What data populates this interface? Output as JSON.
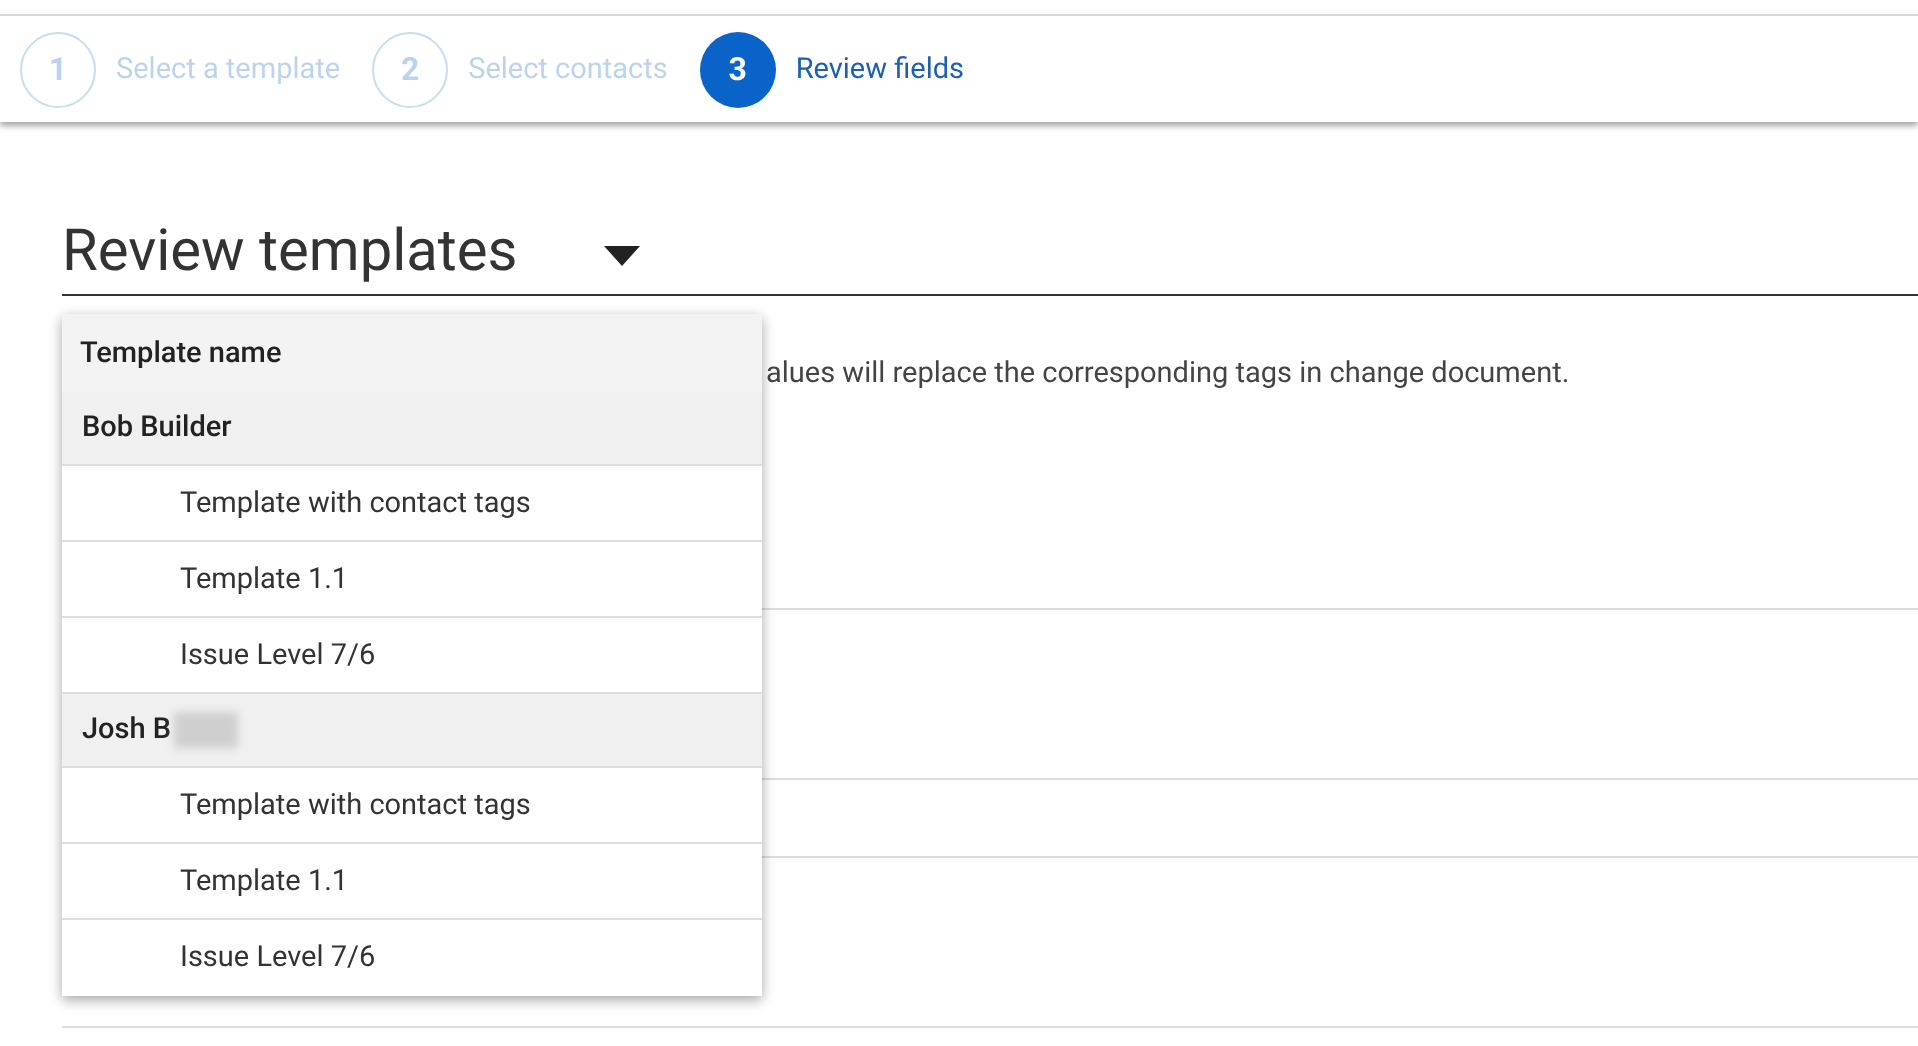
{
  "steps": [
    {
      "number": "1",
      "label": "Select a template",
      "selected": false
    },
    {
      "number": "2",
      "label": "Select contacts",
      "selected": false
    },
    {
      "number": "3",
      "label": "Review fields",
      "selected": true
    }
  ],
  "heading": "Review templates",
  "description": "alues will replace the corresponding tags in change document.",
  "dropdown": {
    "header": "Template name",
    "groups": [
      {
        "name": "Bob Builder",
        "redacted": false,
        "items": [
          "Template with contact tags",
          "Template 1.1",
          "Issue Level 7/6"
        ]
      },
      {
        "name": "Josh B",
        "redacted": true,
        "items": [
          "Template with contact tags",
          "Template 1.1",
          "Issue Level 7/6"
        ]
      }
    ]
  }
}
